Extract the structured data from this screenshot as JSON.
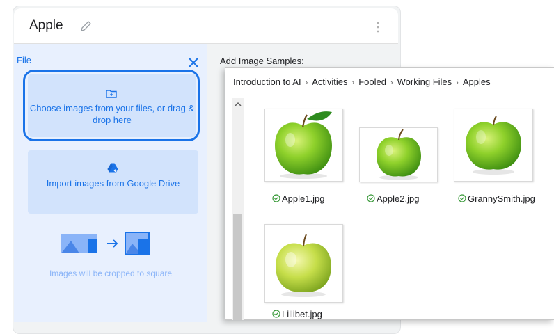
{
  "card": {
    "title": "Apple",
    "file_label": "File",
    "choose_text": "Choose images from your files, or drag & drop here",
    "drive_text": "Import images from Google Drive",
    "crop_text": "Images will be cropped to square",
    "add_samples": "Add Image Samples:"
  },
  "explorer": {
    "breadcrumb": [
      "Introduction to AI",
      "Activities",
      "Fooled",
      "Working Files",
      "Apples"
    ],
    "files": [
      {
        "name": "Apple1.jpg"
      },
      {
        "name": "Apple2.jpg"
      },
      {
        "name": "GrannySmith.jpg"
      },
      {
        "name": "Lillibet.jpg"
      }
    ]
  },
  "colors": {
    "accent": "#1a73e8",
    "panel": "#e8f0fe",
    "button_fill": "#d2e3fc"
  },
  "icons": [
    "pencil-icon",
    "more-vert-icon",
    "close-icon",
    "folder-icon",
    "google-drive-icon",
    "check-circle-icon",
    "chevron-up-icon"
  ]
}
